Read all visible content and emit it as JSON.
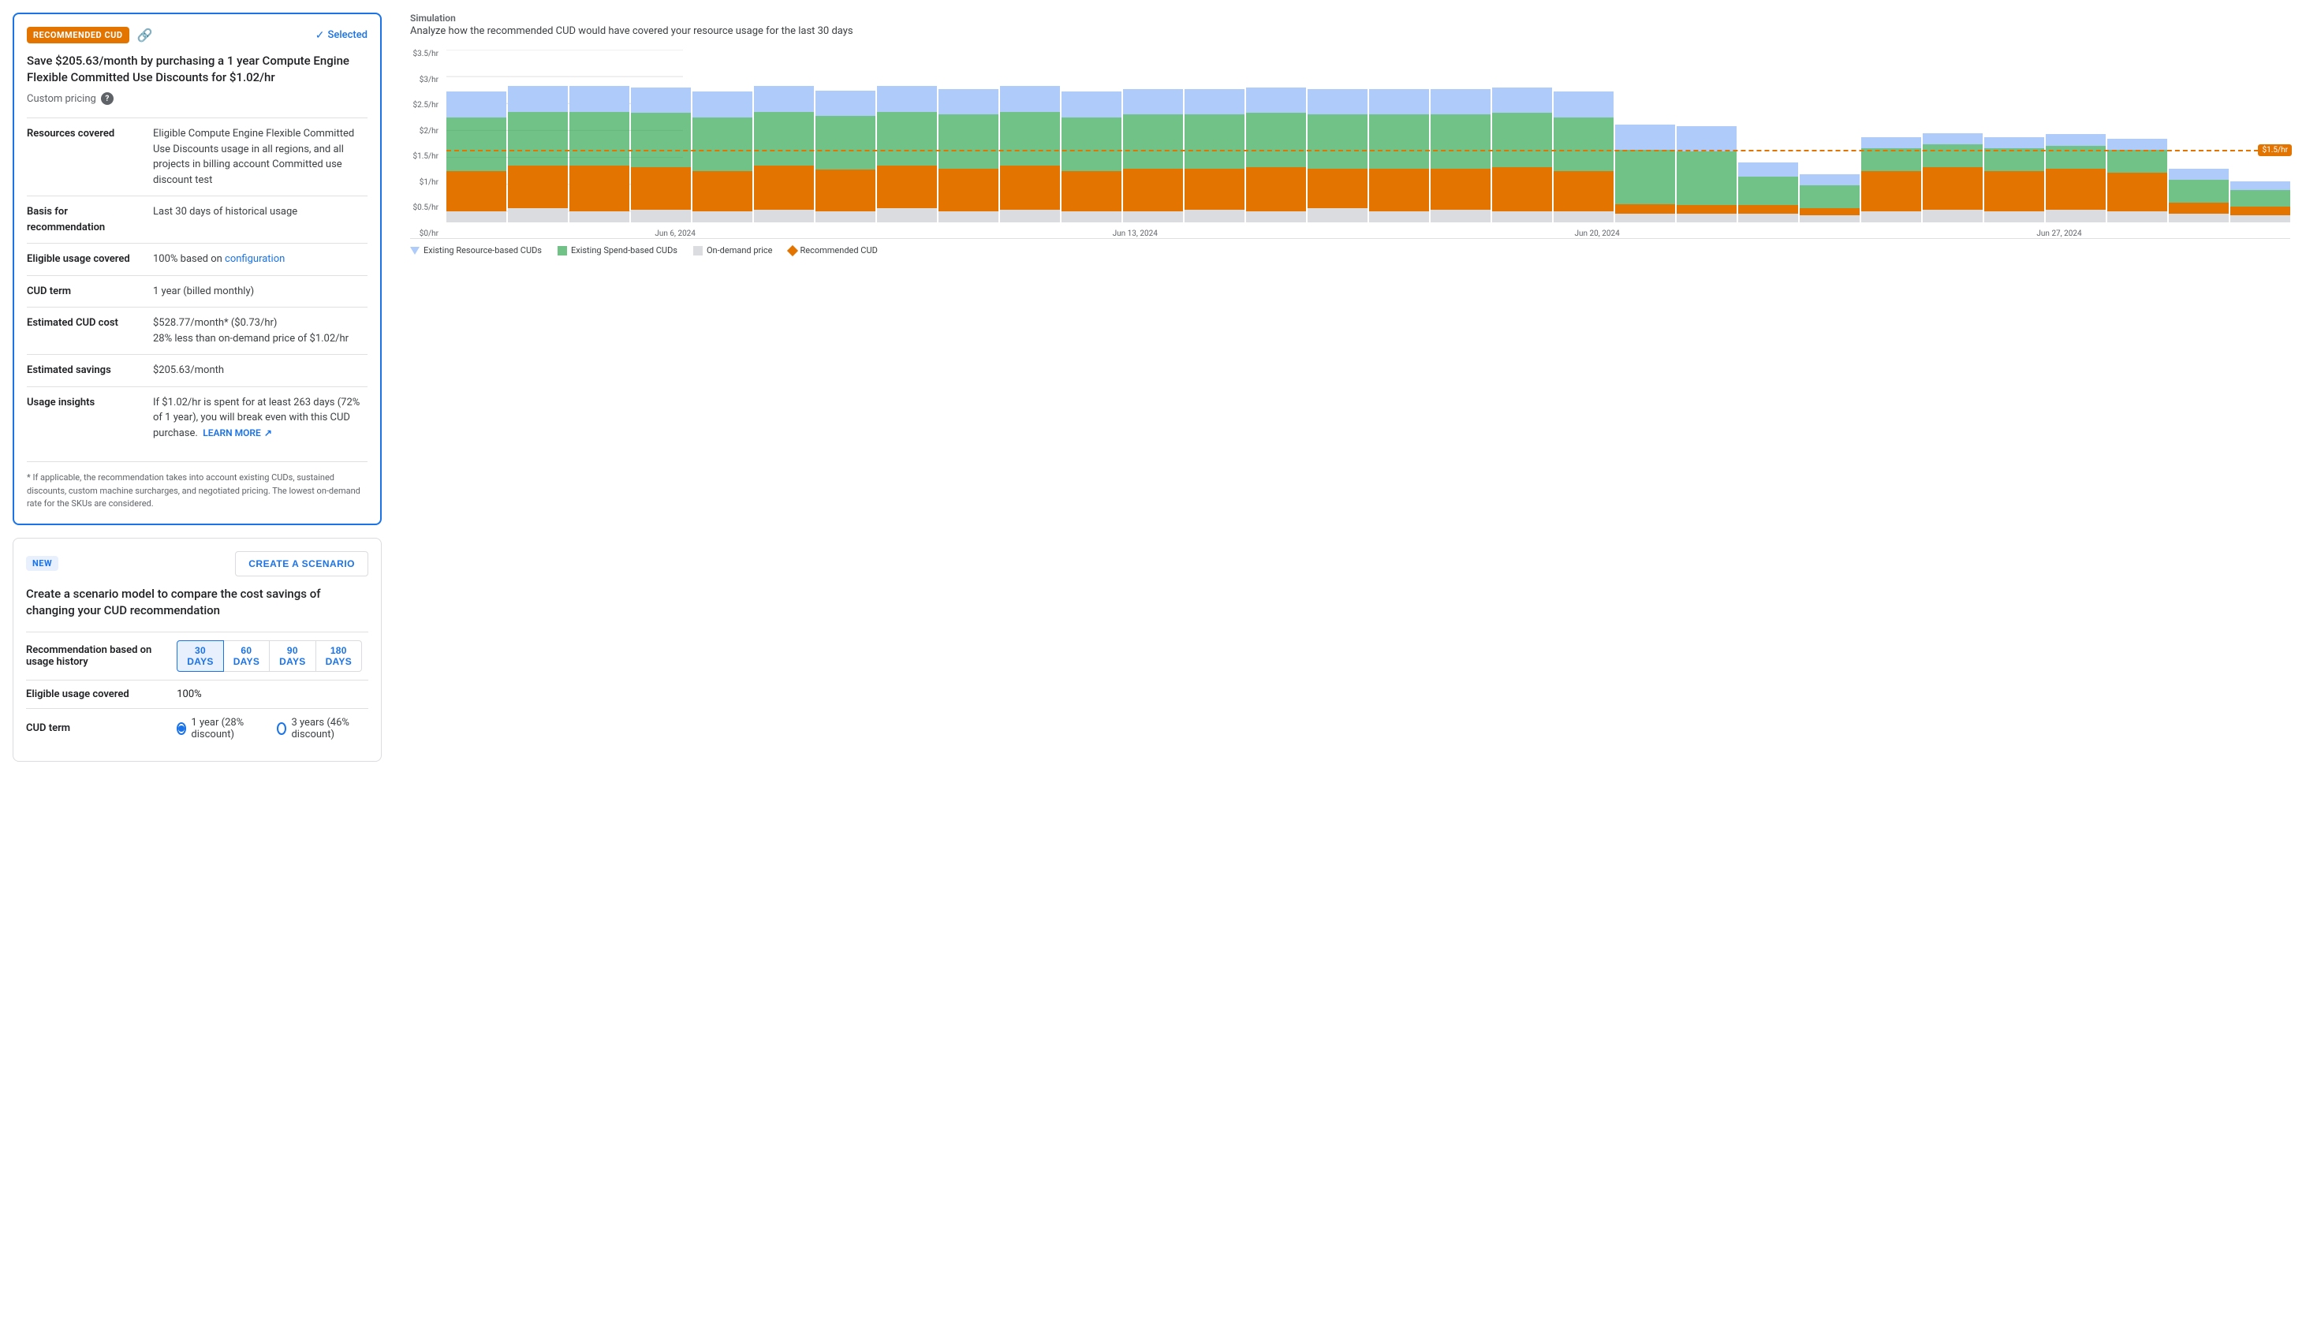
{
  "rec_card": {
    "badge": "RECOMMENDED CUD",
    "selected_label": "Selected",
    "title": "Save $205.63/month by purchasing a 1 year Compute Engine Flexible Committed Use Discounts for $1.02/hr",
    "custom_pricing_label": "Custom pricing",
    "rows": [
      {
        "label": "Resources covered",
        "value": "Eligible Compute Engine Flexible Committed Use Discounts usage in all regions, and all projects in billing account Committed use discount test",
        "has_link": false
      },
      {
        "label": "Basis for recommendation",
        "value": "Last 30 days of historical usage",
        "has_link": false
      },
      {
        "label": "Eligible usage covered",
        "value": "100% based on ",
        "link_text": "configuration",
        "has_link": true
      },
      {
        "label": "CUD term",
        "value": "1 year (billed monthly)",
        "has_link": false
      },
      {
        "label": "Estimated CUD cost",
        "value": "$528.77/month* ($0.73/hr)\n28% less than on-demand price of $1.02/hr",
        "has_link": false
      },
      {
        "label": "Estimated savings",
        "value": "$205.63/month",
        "has_link": false
      },
      {
        "label": "Usage insights",
        "value": "If $1.02/hr is spent for at least 263 days (72% of 1 year), you will break even with this CUD purchase.",
        "has_link": false,
        "learn_more": "LEARN MORE"
      }
    ],
    "footnote": "* If applicable, the recommendation takes into account existing CUDs, sustained discounts, custom machine surcharges, and negotiated pricing. The lowest on-demand rate for the SKUs are considered."
  },
  "scenario_card": {
    "badge": "NEW",
    "create_btn": "CREATE A SCENARIO",
    "title": "Create a scenario model to compare the cost savings of changing your CUD recommendation",
    "rows": [
      {
        "label": "Recommendation based on usage history",
        "type": "days",
        "options": [
          "30 DAYS",
          "60 DAYS",
          "90 DAYS",
          "180 DAYS"
        ],
        "active": 0
      },
      {
        "label": "Eligible usage covered",
        "type": "text",
        "value": "100%"
      },
      {
        "label": "CUD term",
        "type": "radio",
        "options": [
          {
            "label": "1 year (28% discount)",
            "selected": true
          },
          {
            "label": "3 years (46% discount)",
            "selected": false
          }
        ]
      }
    ]
  },
  "simulation": {
    "section_label": "Simulation",
    "subtitle": "Analyze how the recommended CUD would have covered your resource usage for the last 30 days",
    "y_labels": [
      "$3.5/hr",
      "$3/hr",
      "$2.5/hr",
      "$2/hr",
      "$1.5/hr",
      "$1/hr",
      "$0.5/hr",
      "$0/hr"
    ],
    "dashed_value": "$1.5/hr",
    "x_labels": [
      "Jun 6, 2024",
      "Jun 13, 2024",
      "Jun 20, 2024",
      "Jun 27, 2024"
    ],
    "legend": [
      {
        "type": "triangle",
        "label": "Existing Resource-based CUDs"
      },
      {
        "type": "green",
        "label": "Existing Spend-based CUDs"
      },
      {
        "type": "gray",
        "label": "On-demand price"
      },
      {
        "type": "diamond",
        "label": "Recommended CUD"
      }
    ],
    "bars": [
      {
        "blue": 18,
        "green": 38,
        "orange": 28,
        "gray": 8
      },
      {
        "blue": 18,
        "green": 38,
        "orange": 30,
        "gray": 10
      },
      {
        "blue": 18,
        "green": 38,
        "orange": 32,
        "gray": 8
      },
      {
        "blue": 18,
        "green": 38,
        "orange": 30,
        "gray": 9
      },
      {
        "blue": 18,
        "green": 38,
        "orange": 28,
        "gray": 8
      },
      {
        "blue": 18,
        "green": 38,
        "orange": 31,
        "gray": 9
      },
      {
        "blue": 18,
        "green": 38,
        "orange": 29,
        "gray": 8
      },
      {
        "blue": 18,
        "green": 38,
        "orange": 30,
        "gray": 10
      },
      {
        "blue": 18,
        "green": 38,
        "orange": 30,
        "gray": 8
      },
      {
        "blue": 18,
        "green": 38,
        "orange": 31,
        "gray": 9
      },
      {
        "blue": 18,
        "green": 38,
        "orange": 28,
        "gray": 8
      },
      {
        "blue": 18,
        "green": 38,
        "orange": 30,
        "gray": 8
      },
      {
        "blue": 18,
        "green": 38,
        "orange": 29,
        "gray": 9
      },
      {
        "blue": 18,
        "green": 38,
        "orange": 31,
        "gray": 8
      },
      {
        "blue": 18,
        "green": 38,
        "orange": 28,
        "gray": 10
      },
      {
        "blue": 18,
        "green": 38,
        "orange": 30,
        "gray": 8
      },
      {
        "blue": 18,
        "green": 38,
        "orange": 29,
        "gray": 9
      },
      {
        "blue": 18,
        "green": 38,
        "orange": 31,
        "gray": 8
      },
      {
        "blue": 18,
        "green": 38,
        "orange": 28,
        "gray": 8
      },
      {
        "blue": 18,
        "green": 38,
        "orange": 7,
        "gray": 6
      },
      {
        "blue": 18,
        "green": 38,
        "orange": 6,
        "gray": 6
      },
      {
        "blue": 10,
        "green": 20,
        "orange": 6,
        "gray": 6
      },
      {
        "blue": 8,
        "green": 16,
        "orange": 5,
        "gray": 5
      },
      {
        "blue": 8,
        "green": 16,
        "orange": 28,
        "gray": 8
      },
      {
        "blue": 8,
        "green": 16,
        "orange": 30,
        "gray": 9
      },
      {
        "blue": 8,
        "green": 16,
        "orange": 28,
        "gray": 8
      },
      {
        "blue": 8,
        "green": 16,
        "orange": 29,
        "gray": 9
      },
      {
        "blue": 8,
        "green": 16,
        "orange": 27,
        "gray": 8
      },
      {
        "blue": 8,
        "green": 16,
        "orange": 8,
        "gray": 6
      },
      {
        "blue": 6,
        "green": 12,
        "orange": 6,
        "gray": 5
      }
    ]
  }
}
